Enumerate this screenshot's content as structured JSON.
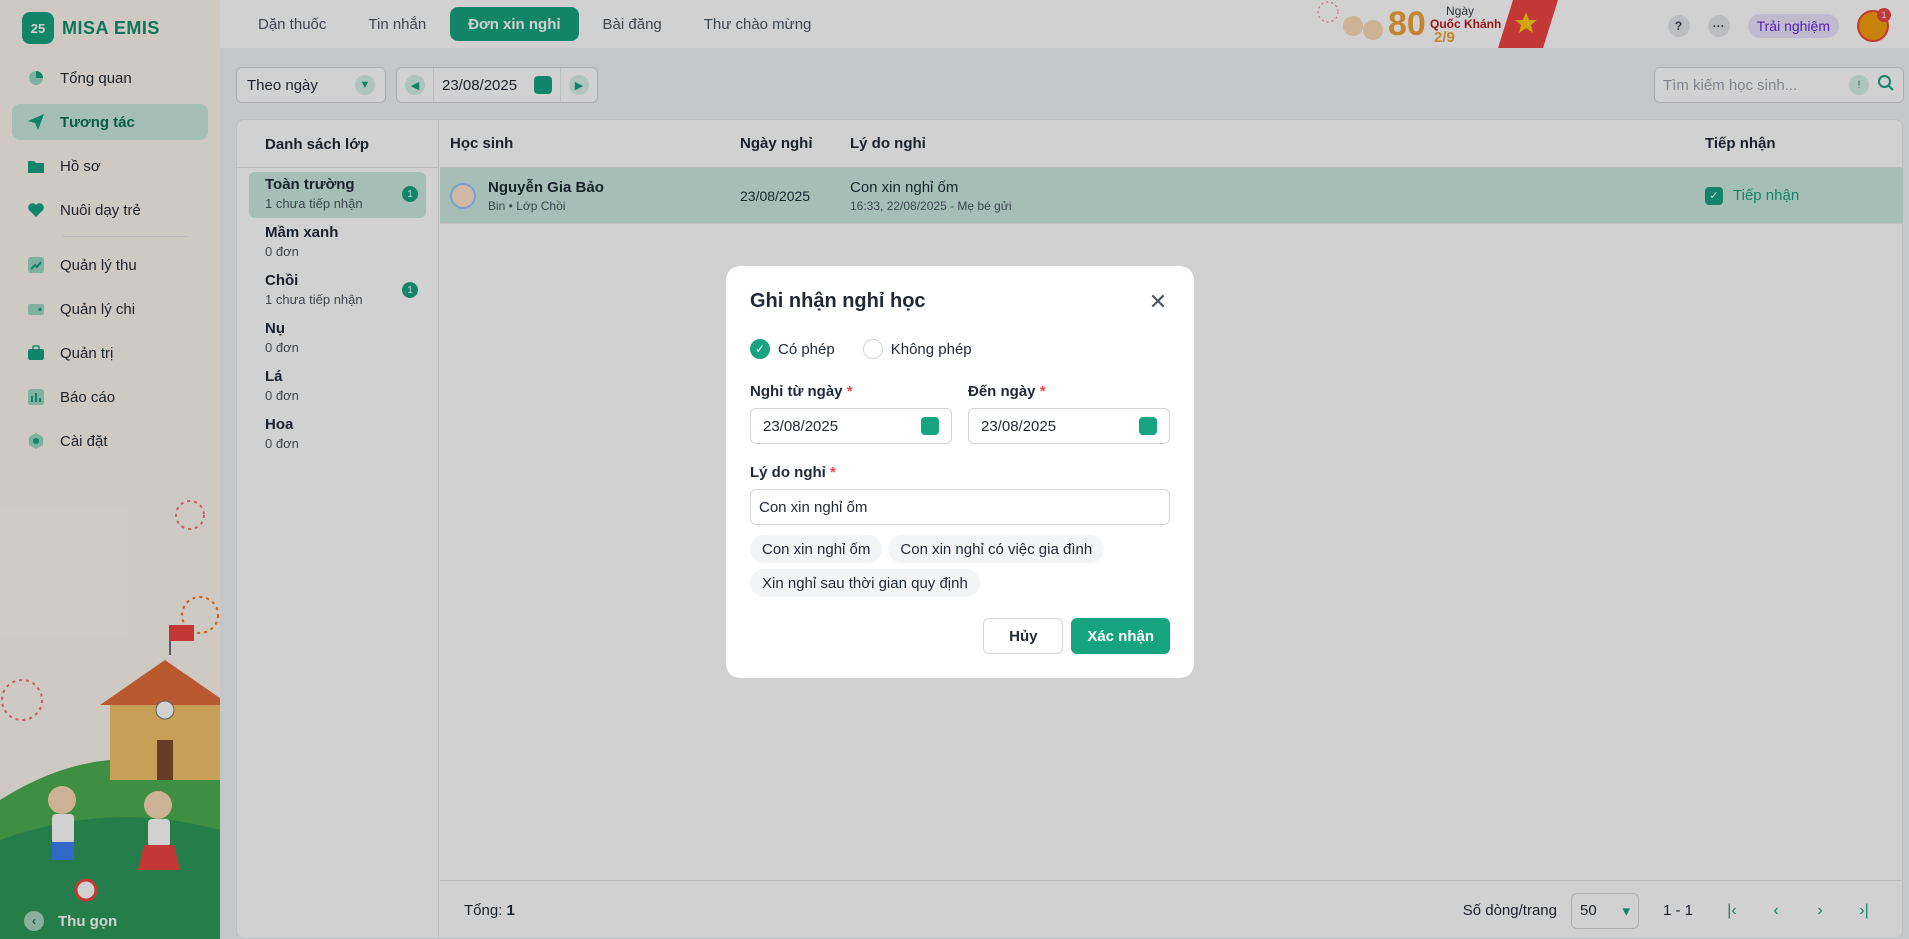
{
  "app": {
    "brand": "MISA EMIS",
    "logo_mark": "25"
  },
  "sidebar": {
    "items": [
      {
        "label": "Tổng quan",
        "icon": "pie-chart-icon"
      },
      {
        "label": "Tương tác",
        "icon": "send-icon",
        "active": true
      },
      {
        "label": "Hồ sơ",
        "icon": "folder-icon"
      },
      {
        "label": "Nuôi dạy trẻ",
        "icon": "heart-icon"
      },
      {
        "label": "Quản lý thu",
        "icon": "trend-up-icon"
      },
      {
        "label": "Quản lý chi",
        "icon": "wallet-icon"
      },
      {
        "label": "Quản trị",
        "icon": "briefcase-icon"
      },
      {
        "label": "Báo cáo",
        "icon": "bar-chart-icon"
      },
      {
        "label": "Cài đặt",
        "icon": "gear-icon"
      }
    ],
    "collapse_label": "Thu gọn"
  },
  "topbar": {
    "tabs": [
      {
        "label": "Dặn thuốc"
      },
      {
        "label": "Tin nhắn"
      },
      {
        "label": "Đơn xin nghỉ",
        "active": true
      },
      {
        "label": "Bài đăng"
      },
      {
        "label": "Thư chào mừng"
      }
    ],
    "banner": {
      "number": "80",
      "line1": "Ngày",
      "line2": "Quốc Khánh",
      "date": "2/9"
    },
    "help": "?",
    "more": "···",
    "trial_label": "Trải nghiệm",
    "notif_count": "1"
  },
  "filter": {
    "mode": "Theo ngày",
    "date": "23/08/2025"
  },
  "search": {
    "placeholder": "Tìm kiếm học sinh..."
  },
  "classes": {
    "title": "Danh sách lớp",
    "items": [
      {
        "name": "Toàn trường",
        "sub": "1 chưa tiếp nhận",
        "badge": "1",
        "active": true
      },
      {
        "name": "Mầm xanh",
        "sub": "0 đơn"
      },
      {
        "name": "Chồi",
        "sub": "1 chưa tiếp nhận",
        "badge": "1"
      },
      {
        "name": "Nụ",
        "sub": "0 đơn"
      },
      {
        "name": "Lá",
        "sub": "0 đơn"
      },
      {
        "name": "Hoa",
        "sub": "0 đơn"
      }
    ]
  },
  "table": {
    "headers": [
      "Học sinh",
      "Ngày nghỉ",
      "Lý do nghỉ",
      "Tiếp nhận"
    ],
    "rows": [
      {
        "name": "Nguyễn Gia Bảo",
        "sub": "Bin • Lớp Chồi",
        "date": "23/08/2025",
        "reason": "Con xin nghỉ ốm",
        "time": "16:33, 22/08/2025 - Mẹ bé gửi",
        "accept": "Tiếp nhận"
      }
    ],
    "total_label": "Tổng:",
    "total": "1",
    "per_page_label": "Số dòng/trang",
    "per_page": "50",
    "range": "1 - 1"
  },
  "modal": {
    "title": "Ghi nhận nghỉ học",
    "radio_yes": "Có phép",
    "radio_no": "Không phép",
    "from_label": "Nghỉ từ ngày",
    "from_value": "23/08/2025",
    "to_label": "Đến ngày",
    "to_value": "23/08/2025",
    "reason_label": "Lý do nghỉ",
    "reason_value": "Con xin nghỉ ốm",
    "chips": [
      "Con xin nghỉ ốm",
      "Con xin nghỉ có việc gia đình",
      "Xin nghỉ sau thời gian quy định"
    ],
    "cancel": "Hủy",
    "confirm": "Xác nhận"
  },
  "colors": {
    "accent": "#16a37f",
    "accent_light": "#cbe9df",
    "required": "#ef4444"
  }
}
